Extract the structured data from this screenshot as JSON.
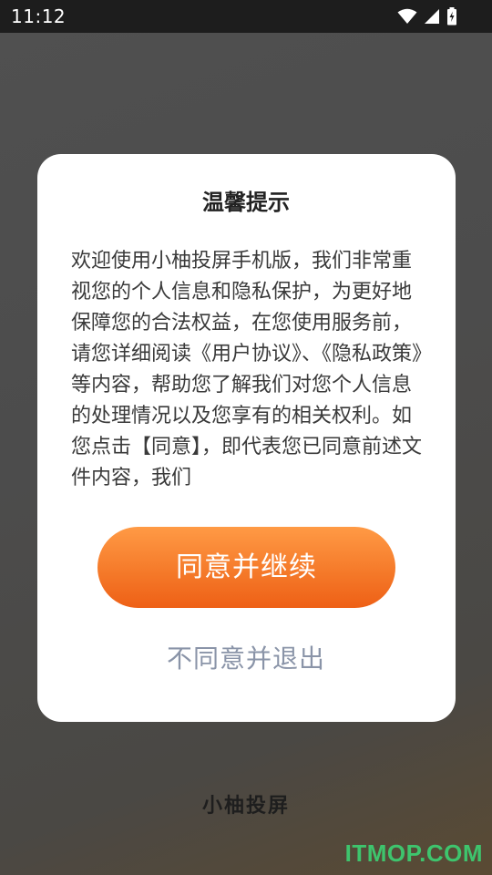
{
  "status_bar": {
    "time": "11:12",
    "icons": [
      "wifi-icon",
      "signal-icon",
      "battery-charging-icon"
    ]
  },
  "dialog": {
    "title": "温馨提示",
    "body": "欢迎使用小柚投屏手机版，我们非常重视您的个人信息和隐私保护，为更好地保障您的合法权益，在您使用服务前，请您详细阅读《用户协议》、《隐私政策》等内容，帮助您了解我们对您个人信息的处理情况以及您享有的相关权利。如您点击【同意】，即代表您已同意前述文件内容，我们",
    "agree_label": "同意并继续",
    "disagree_label": "不同意并退出"
  },
  "background": {
    "app_name": "小柚投屏"
  },
  "watermark": "ITMOP.COM",
  "colors": {
    "accent": "#f57a2a",
    "disagree_text": "#8a94a8",
    "watermark": "#3ec46d"
  }
}
